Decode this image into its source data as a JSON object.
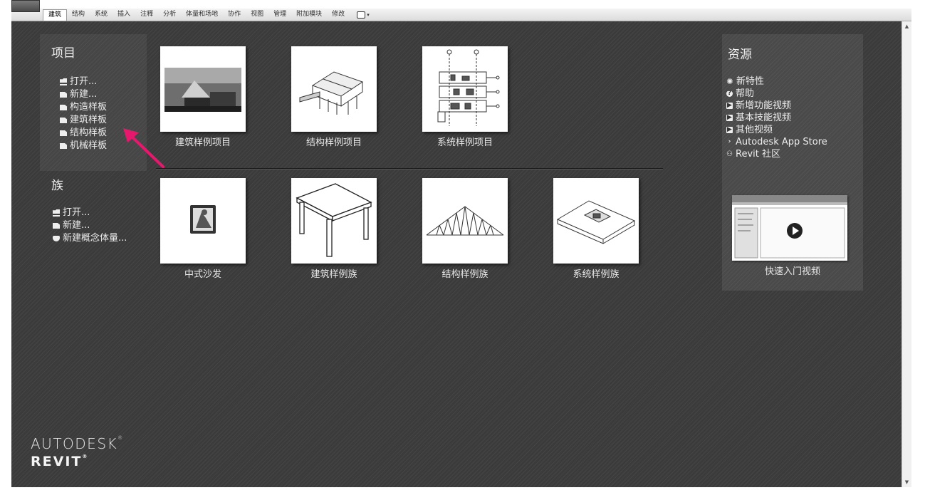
{
  "ribbon": {
    "tabs": [
      "建筑",
      "结构",
      "系统",
      "插入",
      "注释",
      "分析",
      "体量和场地",
      "协作",
      "视图",
      "管理",
      "附加模块",
      "修改"
    ],
    "active_tab": "建筑"
  },
  "projects": {
    "title": "项目",
    "links": [
      "打开...",
      "新建...",
      "构造样板",
      "建筑样板",
      "结构样板",
      "机械样板"
    ],
    "tiles": [
      "建筑样例项目",
      "结构样例项目",
      "系统样例项目"
    ]
  },
  "families": {
    "title": "族",
    "links": [
      "打开...",
      "新建...",
      "新建概念体量..."
    ],
    "tiles": [
      "中式沙发",
      "建筑样例族",
      "结构样例族",
      "系统样例族"
    ]
  },
  "resources": {
    "title": "资源",
    "links": [
      "新特性",
      "帮助",
      "新增功能视频",
      "基本技能视频",
      "其他视频",
      "Autodesk App Store",
      "Revit 社区"
    ],
    "video_label": "快速入门视频"
  },
  "brand": {
    "line1": "AUTODESK",
    "line2": "REVIT"
  },
  "colors": {
    "background": "#3b3b3b",
    "annotation_arrow": "#e5186e"
  },
  "icons": {
    "open": "folder-open-icon",
    "new": "file-icon",
    "mass": "mass-icon",
    "new_features": "sparkle-icon",
    "help": "help-icon",
    "video": "play-icon",
    "app_store": "app-store-icon",
    "community": "community-icon"
  }
}
